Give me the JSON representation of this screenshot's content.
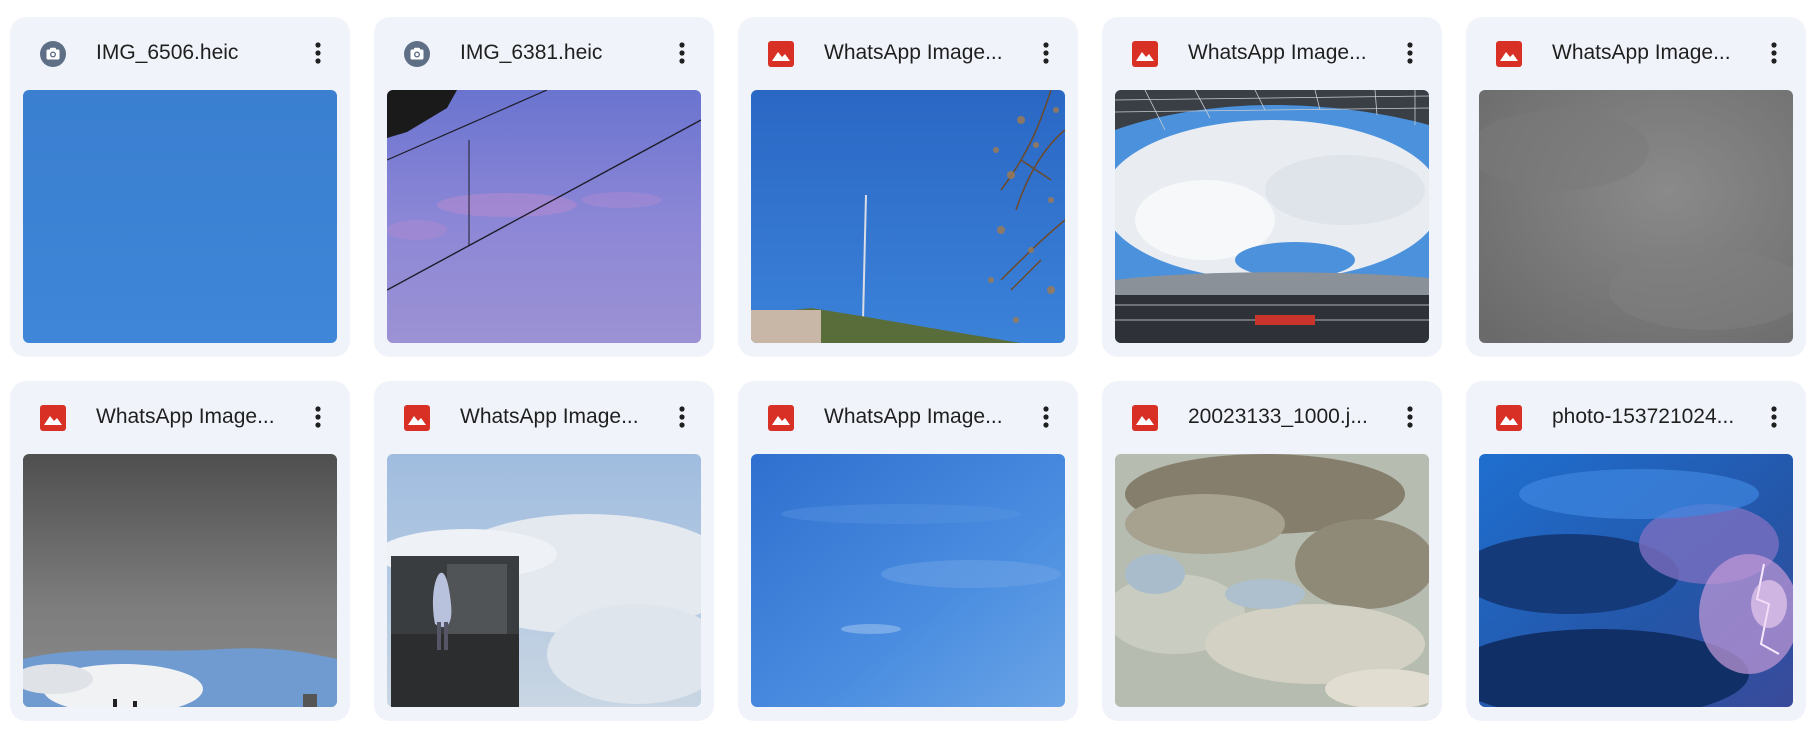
{
  "colors": {
    "card_bg": "#f0f4fa",
    "image_icon_red": "#d93025",
    "camera_icon_slate": "#5f6f86",
    "text": "#1f1f1f"
  },
  "files": [
    {
      "name": "IMG_6506.heic",
      "icon": "camera-icon",
      "thumbnail": "clear blue sky"
    },
    {
      "name": "IMG_6381.heic",
      "icon": "camera-icon",
      "thumbnail": "purple sky with power lines"
    },
    {
      "name": "WhatsApp Image...",
      "icon": "image-icon",
      "thumbnail": "blue sky with antenna and tree"
    },
    {
      "name": "WhatsApp Image...",
      "icon": "image-icon",
      "thumbnail": "stadium roof with clouds"
    },
    {
      "name": "WhatsApp Image...",
      "icon": "image-icon",
      "thumbnail": "grey overcast sky"
    },
    {
      "name": "WhatsApp Image...",
      "icon": "image-icon",
      "thumbnail": "dark grey clouds"
    },
    {
      "name": "WhatsApp Image...",
      "icon": "image-icon",
      "thumbnail": "clouds with ghost figure"
    },
    {
      "name": "WhatsApp Image...",
      "icon": "image-icon",
      "thumbnail": "light blue sky"
    },
    {
      "name": "20023133_1000.j...",
      "icon": "image-icon",
      "thumbnail": "painted clouds"
    },
    {
      "name": "photo-153721024...",
      "icon": "image-icon",
      "thumbnail": "stormy sky with lightning"
    }
  ]
}
